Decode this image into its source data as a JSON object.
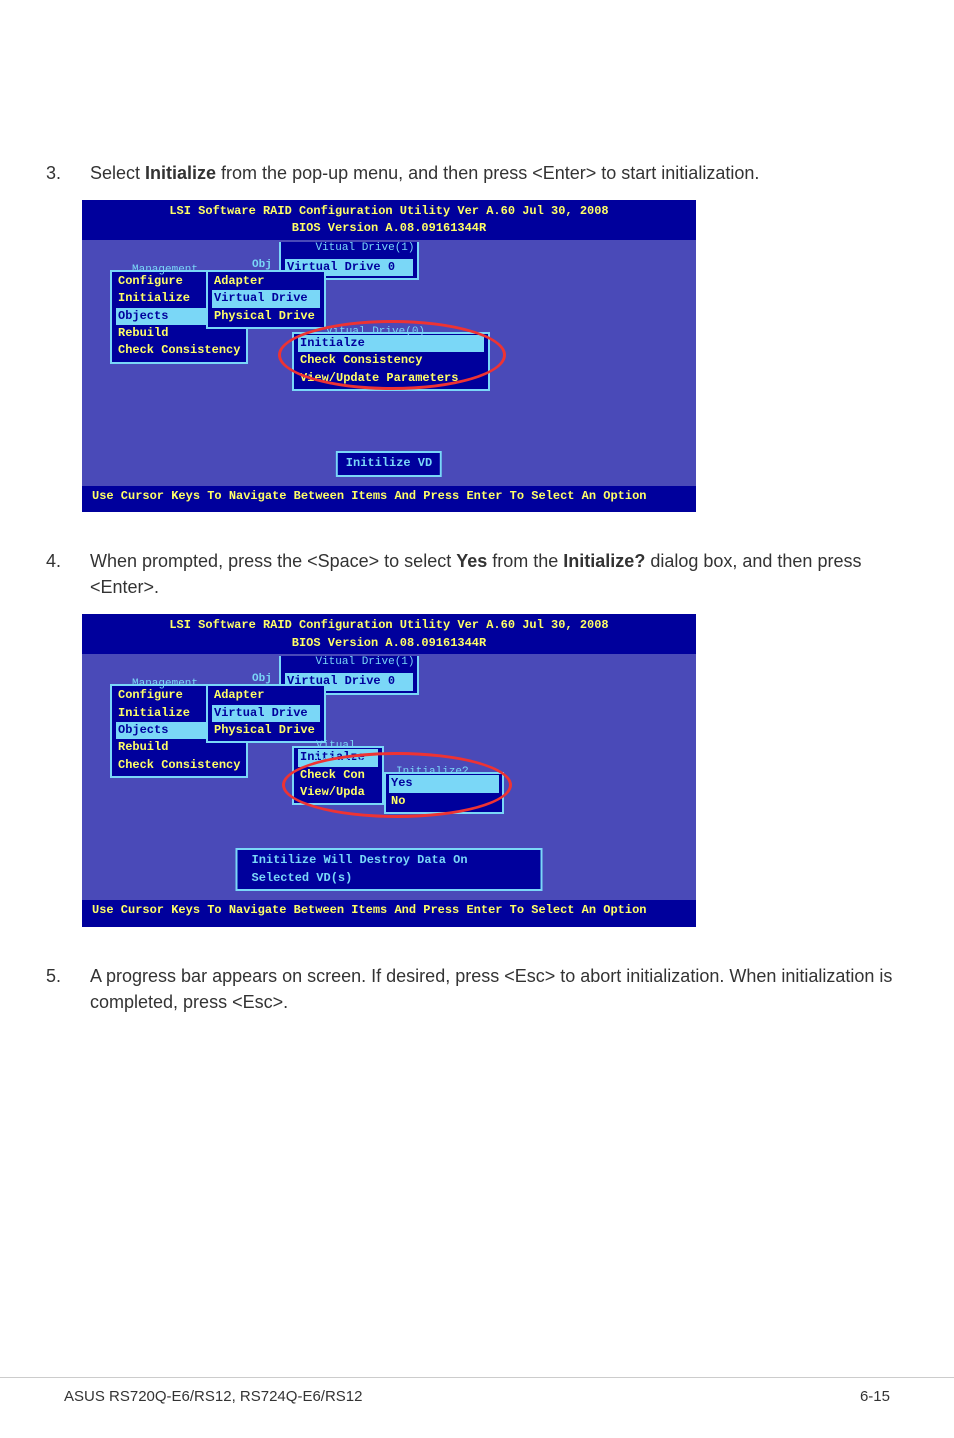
{
  "steps": {
    "s3": {
      "num": "3.",
      "text_a": "Select ",
      "bold_a": "Initialize",
      "text_b": " from the pop-up menu, and then press <Enter> to start initialization."
    },
    "s4": {
      "num": "4.",
      "text_a": "When prompted, press the <Space> to select ",
      "bold_a": "Yes",
      "text_b": " from the ",
      "bold_b": "Initialize?",
      "text_c": " dialog box, and then press <Enter>."
    },
    "s5": {
      "num": "5.",
      "text_a": "A progress bar appears on screen. If desired, press <Esc> to abort initialization. When initialization is completed, press <Esc>."
    }
  },
  "bios": {
    "header": "LSI Software RAID Configuration Utility Ver A.60 Jul 30, 2008",
    "subheader": "BIOS Version   A.08.09161344R",
    "obj_label": "Obj",
    "mgmt_title": "Management",
    "mgmt_items": [
      "Configure",
      "Initialize",
      "Objects",
      "Rebuild",
      "Check Consistency"
    ],
    "objs_items": [
      "Adapter",
      "Virtual Drive",
      "Physical Drive"
    ],
    "vd1_title": "Vitual Drive(1)",
    "vd1_item": "Virtual Drive 0",
    "vd0_title": "Vitual Drive(0)",
    "vd0_items_a": [
      "Initialze",
      "Check Consistency",
      "View/Update Parameters"
    ],
    "vd0_items_b": [
      "Initialze",
      "Check Con",
      "View/Upda"
    ],
    "confirm_title": "Initialize?",
    "confirm_items": [
      "Yes",
      "No"
    ],
    "button_a": "Initilize VD",
    "button_b": "Initilize Will Destroy Data On Selected VD(s)",
    "footer": "Use Cursor Keys To Navigate Between Items And Press Enter To Select An Option"
  },
  "page_footer": {
    "left": "ASUS RS720Q-E6/RS12, RS724Q-E6/RS12",
    "right": "6-15"
  }
}
